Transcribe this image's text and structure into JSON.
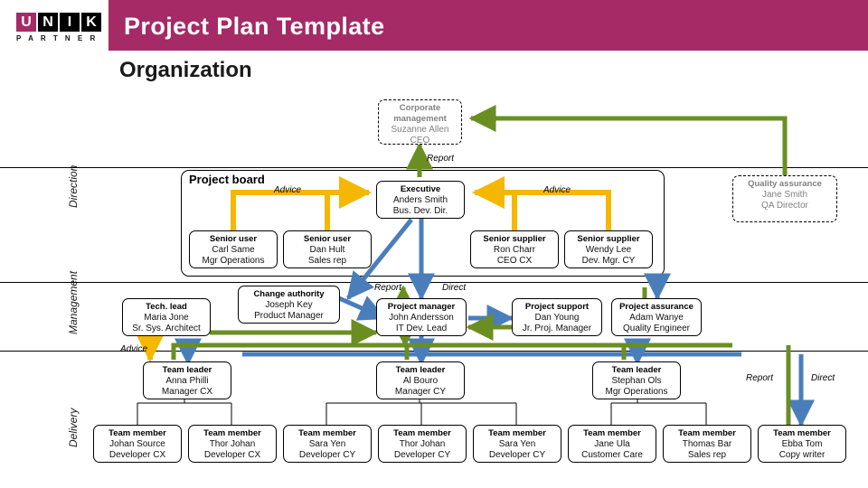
{
  "header": {
    "title": "Project Plan Template",
    "logo": {
      "letters": [
        "U",
        "N",
        "I",
        "K"
      ],
      "subtitle": "P A R T N E R",
      "accent_color": "#a52a66"
    }
  },
  "page_title": "Organization",
  "bands": [
    {
      "label": "Direction"
    },
    {
      "label": "Management"
    },
    {
      "label": "Delivery"
    }
  ],
  "colors": {
    "header_bar": "#a52a66",
    "report_arrow": "#6b8e23",
    "direct_arrow": "#4a7ebb",
    "advice_arrow": "#f5b700",
    "dashed_text": "#808080"
  },
  "groups": [
    {
      "title": "Project board"
    }
  ],
  "legend": [
    {
      "label": "Report",
      "color": "#6b8e23"
    },
    {
      "label": "Direct",
      "color": "#4a7ebb"
    }
  ],
  "edge_labels": {
    "report_top": "Report",
    "advice_left": "Advice",
    "advice_right": "Advice",
    "report_pm": "Report",
    "direct_pm": "Direct",
    "advice_tech": "Advice"
  },
  "nodes": {
    "corporate": {
      "role": "Corporate management",
      "name": "Suzanne Allen",
      "title": "CEO"
    },
    "executive": {
      "role": "Executive",
      "name": "Anders Smith",
      "title": "Bus. Dev. Dir."
    },
    "quality_assurance": {
      "role": "Quality assurance",
      "name": "Jane Smith",
      "title": "QA Director"
    },
    "senior_user_1": {
      "role": "Senior user",
      "name": "Carl Same",
      "title": "Mgr Operations"
    },
    "senior_user_2": {
      "role": "Senior user",
      "name": "Dan Hult",
      "title": "Sales rep"
    },
    "senior_supplier_1": {
      "role": "Senior supplier",
      "name": "Ron Charr",
      "title": "CEO CX"
    },
    "senior_supplier_2": {
      "role": "Senior supplier",
      "name": "Wendy Lee",
      "title": "Dev. Mgr. CY"
    },
    "tech_lead": {
      "role": "Tech. lead",
      "name": "Maria Jone",
      "title": "Sr. Sys. Architect"
    },
    "change_authority": {
      "role": "Change authority",
      "name": "Joseph Key",
      "title": "Product Manager"
    },
    "project_manager": {
      "role": "Project manager",
      "name": "John Andersson",
      "title": "IT Dev. Lead"
    },
    "project_support": {
      "role": "Project support",
      "name": "Dan Young",
      "title": "Jr. Proj. Manager"
    },
    "project_assurance": {
      "role": "Project assurance",
      "name": "Adam Wanye",
      "title": "Quality Engineer"
    },
    "team_leader_1": {
      "role": "Team leader",
      "name": "Anna Philli",
      "title": "Manager CX"
    },
    "team_leader_2": {
      "role": "Team leader",
      "name": "Al Bouro",
      "title": "Manager CY"
    },
    "team_leader_3": {
      "role": "Team leader",
      "name": "Stephan Ols",
      "title": "Mgr Operations"
    },
    "team_member_1": {
      "role": "Team member",
      "name": "Johan Source",
      "title": "Developer CX"
    },
    "team_member_2": {
      "role": "Team member",
      "name": "Thor Johan",
      "title": "Developer CX"
    },
    "team_member_3": {
      "role": "Team member",
      "name": "Sara Yen",
      "title": "Developer CY"
    },
    "team_member_4": {
      "role": "Team member",
      "name": "Thor Johan",
      "title": "Developer CY"
    },
    "team_member_5": {
      "role": "Team member",
      "name": "Sara Yen",
      "title": "Developer CY"
    },
    "team_member_6": {
      "role": "Team member",
      "name": "Jane Ula",
      "title": "Customer Care"
    },
    "team_member_7": {
      "role": "Team member",
      "name": "Thomas Bar",
      "title": "Sales rep"
    },
    "team_member_8": {
      "role": "Team member",
      "name": "Ebba Tom",
      "title": "Copy writer"
    }
  }
}
